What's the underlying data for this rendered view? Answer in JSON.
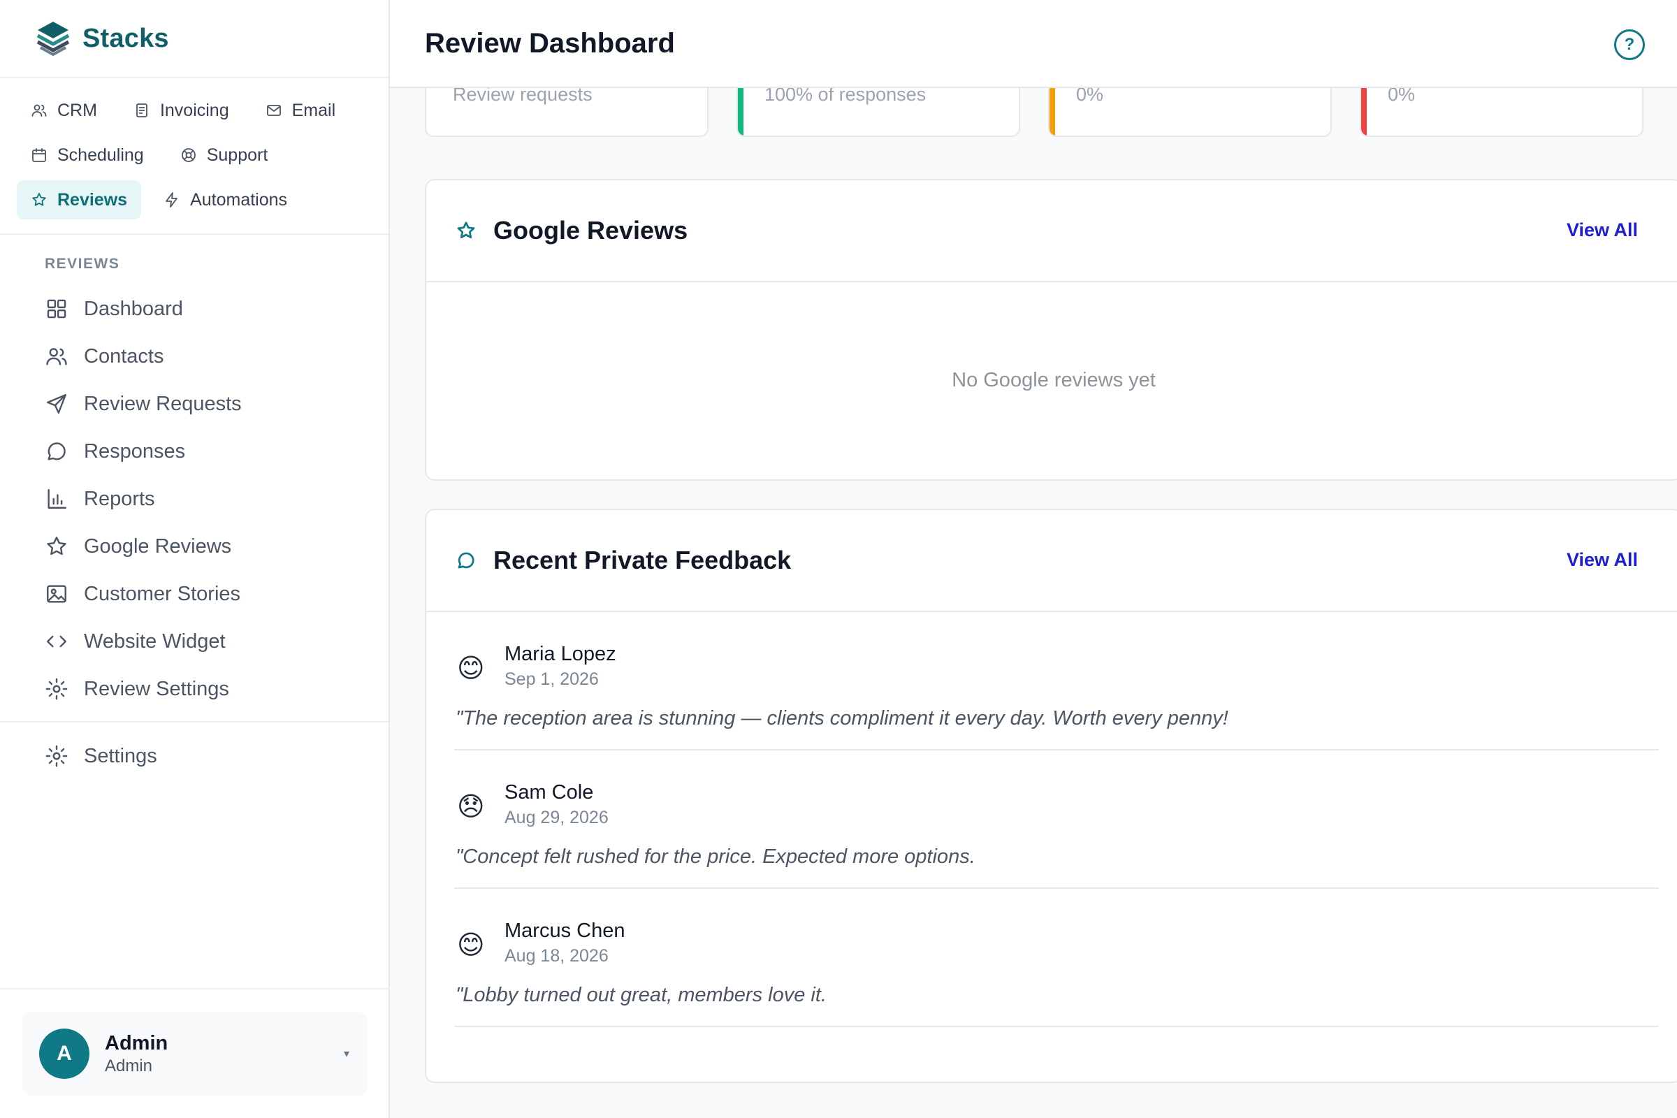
{
  "brand": {
    "name": "Stacks"
  },
  "apps": [
    {
      "label": "CRM",
      "icon": "users-icon",
      "active": false
    },
    {
      "label": "Invoicing",
      "icon": "document-icon",
      "active": false
    },
    {
      "label": "Email",
      "icon": "mail-icon",
      "active": false
    },
    {
      "label": "Scheduling",
      "icon": "calendar-icon",
      "active": false
    },
    {
      "label": "Support",
      "icon": "lifebuoy-icon",
      "active": false
    },
    {
      "label": "Reviews",
      "icon": "star-icon",
      "active": true
    },
    {
      "label": "Automations",
      "icon": "bolt-icon",
      "active": false
    }
  ],
  "sidebar": {
    "section_label": "REVIEWS",
    "items": [
      {
        "label": "Dashboard",
        "icon": "grid-icon"
      },
      {
        "label": "Contacts",
        "icon": "users-icon"
      },
      {
        "label": "Review Requests",
        "icon": "send-icon"
      },
      {
        "label": "Responses",
        "icon": "chat-icon"
      },
      {
        "label": "Reports",
        "icon": "bar-chart-icon"
      },
      {
        "label": "Google Reviews",
        "icon": "star-icon"
      },
      {
        "label": "Customer Stories",
        "icon": "image-icon"
      },
      {
        "label": "Website Widget",
        "icon": "code-icon"
      },
      {
        "label": "Review Settings",
        "icon": "gear-icon"
      }
    ],
    "settings_label": "Settings"
  },
  "user": {
    "initial": "A",
    "name": "Admin",
    "role": "Admin"
  },
  "header": {
    "title": "Review Dashboard",
    "help": "?"
  },
  "stats": [
    {
      "sub": "Review requests",
      "accent": ""
    },
    {
      "sub": "100% of responses",
      "accent": "#10b981"
    },
    {
      "sub": "0%",
      "accent": "#f59e0b"
    },
    {
      "sub": "0%",
      "accent": "#ef4444"
    }
  ],
  "google_reviews": {
    "title": "Google Reviews",
    "view_all": "View All",
    "empty": "No Google reviews yet"
  },
  "private_feedback": {
    "title": "Recent Private Feedback",
    "view_all": "View All",
    "items": [
      {
        "emoji": "😊",
        "name": "Maria Lopez",
        "date": "Sep 1, 2026",
        "text": "\"The reception area is stunning — clients compliment it every day. Worth every penny!"
      },
      {
        "emoji": "😞",
        "name": "Sam Cole",
        "date": "Aug 29, 2026",
        "text": "\"Concept felt rushed for the price. Expected more options."
      },
      {
        "emoji": "😊",
        "name": "Marcus Chen",
        "date": "Aug 18, 2026",
        "text": "\"Lobby turned out great, members love it."
      }
    ]
  },
  "colors": {
    "brand": "#0f5f68",
    "accent": "#0f7a86",
    "link": "#1d1dd6"
  }
}
